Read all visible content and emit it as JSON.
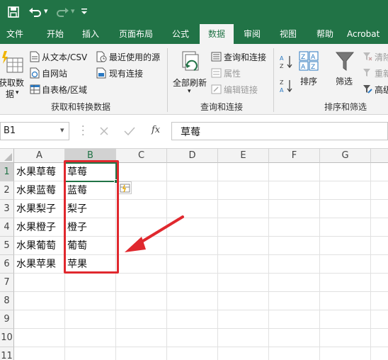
{
  "qat": {
    "dropdown_glyph": "▾"
  },
  "tabs": [
    "文件",
    "开始",
    "插入",
    "页面布局",
    "公式",
    "数据",
    "审阅",
    "视图",
    "帮助",
    "Acrobat"
  ],
  "active_tab": "数据",
  "ribbon": {
    "get_transform": {
      "get_data_label_line1": "获取数",
      "get_data_label_line2": "据",
      "from_text_csv": "从文本/CSV",
      "from_web": "自网站",
      "from_table_range": "自表格/区域",
      "recent_sources": "最近使用的源",
      "existing_connections": "现有连接",
      "group_label": "获取和转换数据"
    },
    "queries": {
      "refresh_all_line1": "全部刷新",
      "queries_connections": "查询和连接",
      "properties": "属性",
      "edit_links": "编辑链接",
      "group_label": "查询和连接"
    },
    "sort_filter": {
      "sort": "排序",
      "filter": "筛选",
      "clear": "清除",
      "reapply": "重新",
      "advanced": "高级",
      "group_label": "排序和筛选"
    }
  },
  "formula_bar": {
    "name_box": "B1",
    "fx": "fx",
    "content": "草莓"
  },
  "sheet": {
    "columns": [
      "A",
      "B",
      "C",
      "D",
      "E",
      "F",
      "G"
    ],
    "rows": [
      "1",
      "2",
      "3",
      "4",
      "5",
      "6",
      "7",
      "8",
      "9",
      "10",
      "11"
    ],
    "col_a": [
      "水果草莓",
      "水果蓝莓",
      "水果梨子",
      "水果橙子",
      "水果葡萄",
      "水果苹果"
    ],
    "col_b": [
      "草莓",
      "蓝莓",
      "梨子",
      "橙子",
      "葡萄",
      "苹果"
    ]
  },
  "colors": {
    "excel_green": "#217346",
    "highlight_red": "#e0282e"
  }
}
